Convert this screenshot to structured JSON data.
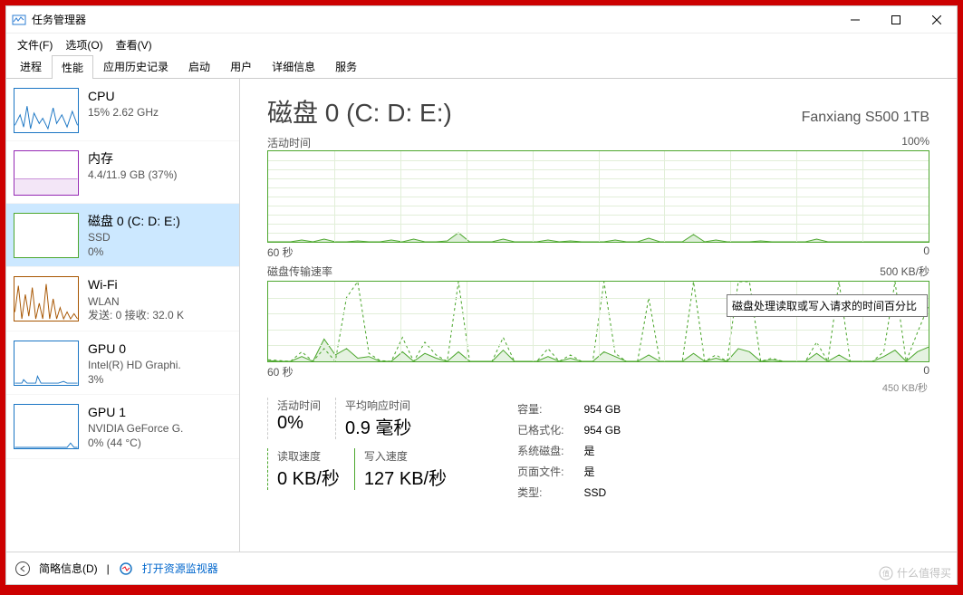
{
  "window": {
    "title": "任务管理器"
  },
  "menu": {
    "file": "文件(F)",
    "options": "选项(O)",
    "view": "查看(V)"
  },
  "tabs": [
    "进程",
    "性能",
    "应用历史记录",
    "启动",
    "用户",
    "详细信息",
    "服务"
  ],
  "sidebar": {
    "cpu": {
      "title": "CPU",
      "line": "15% 2.62 GHz"
    },
    "mem": {
      "title": "内存",
      "line": "4.4/11.9 GB (37%)"
    },
    "disk": {
      "title": "磁盘 0 (C: D: E:)",
      "line1": "SSD",
      "line2": "0%"
    },
    "wifi": {
      "title": "Wi-Fi",
      "line1": "WLAN",
      "line2": "发送: 0 接收: 32.0 K"
    },
    "gpu0": {
      "title": "GPU 0",
      "line1": "Intel(R) HD Graphi.",
      "line2": "3%"
    },
    "gpu1": {
      "title": "GPU 1",
      "line1": "NVIDIA GeForce G.",
      "line2": "0% (44 °C)"
    }
  },
  "main": {
    "title": "磁盘 0 (C: D: E:)",
    "model": "Fanxiang S500 1TB",
    "chart1_label": "活动时间",
    "chart1_max": "100%",
    "chart1_xl": "60 秒",
    "chart1_xr": "0",
    "chart2_label": "磁盘传输速率",
    "chart2_max": "500 KB/秒",
    "chart2_limit": "450 KB/秒",
    "chart2_xl": "60 秒",
    "chart2_xr": "0",
    "tooltip": "磁盘处理读取或写入请求的时间百分比"
  },
  "stats": {
    "active_label": "活动时间",
    "active_value": "0%",
    "resp_label": "平均响应时间",
    "resp_value": "0.9 毫秒",
    "read_label": "读取速度",
    "read_value": "0 KB/秒",
    "write_label": "写入速度",
    "write_value": "127 KB/秒"
  },
  "info": {
    "capacity_l": "容量:",
    "capacity_v": "954 GB",
    "formatted_l": "已格式化:",
    "formatted_v": "954 GB",
    "sysdisk_l": "系统磁盘:",
    "sysdisk_v": "是",
    "pagefile_l": "页面文件:",
    "pagefile_v": "是",
    "type_l": "类型:",
    "type_v": "SSD"
  },
  "footer": {
    "less": "简略信息(D)",
    "resmon": "打开资源监视器"
  },
  "watermark": "什么值得买",
  "chart_data": [
    {
      "type": "area",
      "title": "活动时间",
      "ylabel": "%",
      "ylim": [
        0,
        100
      ],
      "x_range_seconds": [
        60,
        0
      ],
      "values": [
        0,
        0,
        0,
        2,
        0,
        3,
        0,
        0,
        1,
        0,
        0,
        2,
        0,
        3,
        0,
        0,
        1,
        10,
        0,
        0,
        0,
        3,
        0,
        0,
        0,
        2,
        0,
        1,
        0,
        0,
        0,
        2,
        0,
        0,
        4,
        0,
        0,
        0,
        8,
        0,
        2,
        0,
        0,
        0,
        1,
        0,
        0,
        0,
        0,
        3,
        0,
        0,
        0,
        0,
        0,
        0,
        0,
        0,
        0,
        0
      ]
    },
    {
      "type": "line",
      "title": "磁盘传输速率",
      "ylabel": "KB/秒",
      "ylim": [
        0,
        500
      ],
      "x_range_seconds": [
        60,
        0
      ],
      "series": [
        {
          "name": "读取",
          "dashed": true,
          "values": [
            10,
            5,
            0,
            60,
            0,
            80,
            0,
            400,
            500,
            50,
            5,
            0,
            150,
            0,
            120,
            40,
            0,
            500,
            0,
            0,
            0,
            150,
            0,
            0,
            0,
            80,
            0,
            40,
            0,
            0,
            500,
            50,
            0,
            0,
            400,
            0,
            0,
            0,
            500,
            0,
            40,
            0,
            500,
            500,
            0,
            20,
            0,
            0,
            0,
            120,
            0,
            500,
            0,
            0,
            0,
            60,
            500,
            0,
            180,
            350
          ]
        },
        {
          "name": "写入",
          "dashed": false,
          "values": [
            5,
            0,
            0,
            30,
            0,
            140,
            40,
            80,
            20,
            30,
            0,
            0,
            60,
            0,
            50,
            20,
            0,
            60,
            0,
            0,
            0,
            70,
            0,
            0,
            0,
            30,
            0,
            20,
            0,
            0,
            60,
            30,
            0,
            0,
            40,
            0,
            0,
            0,
            50,
            0,
            20,
            0,
            80,
            60,
            0,
            10,
            0,
            0,
            0,
            50,
            0,
            40,
            0,
            0,
            0,
            30,
            70,
            0,
            60,
            90
          ]
        }
      ]
    }
  ]
}
